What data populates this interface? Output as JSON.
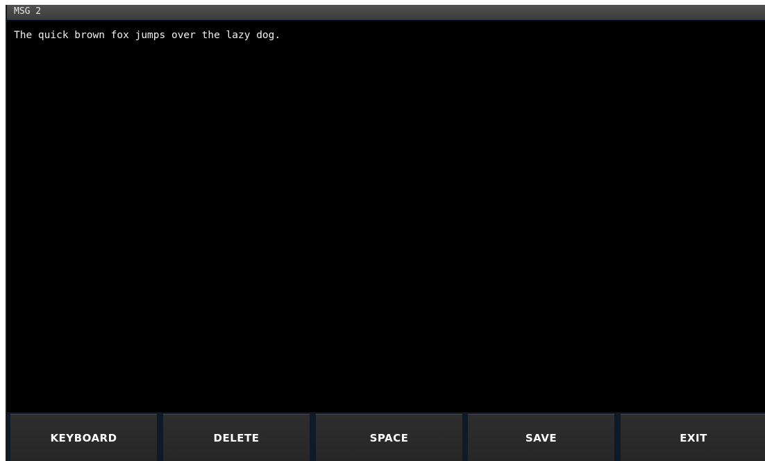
{
  "window": {
    "title": "MSG 2"
  },
  "message": {
    "text": "The quick brown fox jumps over the lazy dog."
  },
  "softkeys": {
    "keyboard": "KEYBOARD",
    "delete": "DELETE",
    "space": "SPACE",
    "save": "SAVE",
    "exit": "EXIT"
  },
  "colors": {
    "background": "#000000",
    "title_bar": "#474747",
    "softkey_bg": "#2a2a2a",
    "softkey_bar_bg": "#0e1a28",
    "text": "#f2f2f2"
  }
}
